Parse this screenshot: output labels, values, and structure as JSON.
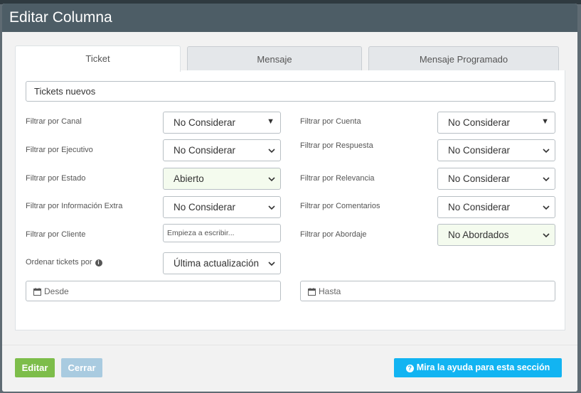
{
  "modal": {
    "title": "Editar Columna"
  },
  "tabs": [
    {
      "label": "Ticket"
    },
    {
      "label": "Mensaje"
    },
    {
      "label": "Mensaje Programado"
    }
  ],
  "form": {
    "column_name_value": "Tickets nuevos",
    "canal": {
      "label": "Filtrar por Canal",
      "value": "No Considerar"
    },
    "cuenta": {
      "label": "Filtrar por Cuenta",
      "value": "No Considerar"
    },
    "ejecutivo": {
      "label": "Filtrar por Ejecutivo",
      "value": "No Considerar"
    },
    "respuesta": {
      "label": "Filtrar por Respuesta",
      "value": "No Considerar"
    },
    "estado": {
      "label": "Filtrar por Estado",
      "value": "Abierto"
    },
    "relevancia": {
      "label": "Filtrar por Relevancia",
      "value": "No Considerar"
    },
    "info_extra": {
      "label": "Filtrar por Información Extra",
      "value": "No Considerar"
    },
    "comentarios": {
      "label": "Filtrar por Comentarios",
      "value": "No Considerar"
    },
    "cliente": {
      "label": "Filtrar por Cliente",
      "placeholder": "Empieza a escribir..."
    },
    "abordaje": {
      "label": "Filtrar por Abordaje",
      "value": "No Abordados"
    },
    "orden": {
      "label": "Ordenar tickets por",
      "value": "Última actualización"
    },
    "desde": {
      "placeholder": "Desde"
    },
    "hasta": {
      "placeholder": "Hasta"
    }
  },
  "footer": {
    "edit_label": "Editar",
    "close_label": "Cerrar",
    "help_label": "Mira la ayuda para esta sección"
  },
  "colors": {
    "header_bg": "#4d5d66",
    "edit_button": "#7dbd4a",
    "close_button": "#a9cbe0",
    "help_button": "#12b4f2",
    "highlight_select": "#f4fbee"
  },
  "icons": {
    "info": "info-icon",
    "calendar": "calendar-icon",
    "help": "question-circle-icon",
    "dropdown": "chevron-down-icon"
  }
}
